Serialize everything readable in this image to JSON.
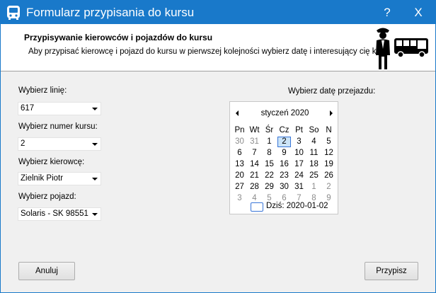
{
  "window": {
    "title": "Formularz przypisania do kursu",
    "help_label": "?",
    "close_label": "X",
    "accent": "#1979ca"
  },
  "header": {
    "title": "Przypisywanie kierowców i pojazdów do kursu",
    "description": "Aby przypisać kierowcę i pojazd do kursu w pierwszej kolejności wybierz datę i interesujący cię kurs.",
    "art_icons": [
      "driver-icon",
      "bus-icon"
    ]
  },
  "form": {
    "line_label": "Wybierz linię:",
    "line_value": "617",
    "course_label": "Wybierz numer kursu:",
    "course_value": "2",
    "driver_label": "Wybierz kierowcę:",
    "driver_value": "Zielnik Piotr",
    "vehicle_label": "Wybierz pojazd:",
    "vehicle_value": "Solaris - SK 98551",
    "date_label": "Wybierz datę przejazdu:"
  },
  "calendar": {
    "month_label": "styczeń 2020",
    "weekdays": [
      "Pn",
      "Wt",
      "Śr",
      "Cz",
      "Pt",
      "So",
      "N"
    ],
    "weeks": [
      [
        "30",
        "31",
        "1",
        "2",
        "3",
        "4",
        "5"
      ],
      [
        "6",
        "7",
        "8",
        "9",
        "10",
        "11",
        "12"
      ],
      [
        "13",
        "14",
        "15",
        "16",
        "17",
        "18",
        "19"
      ],
      [
        "20",
        "21",
        "22",
        "23",
        "24",
        "25",
        "26"
      ],
      [
        "27",
        "28",
        "29",
        "30",
        "31",
        "1",
        "2"
      ],
      [
        "3",
        "4",
        "5",
        "6",
        "7",
        "8",
        "9"
      ]
    ],
    "selected_day": "2",
    "today_label": "Dziś: 2020-01-02"
  },
  "buttons": {
    "cancel": "Anuluj",
    "assign": "Przypisz"
  }
}
